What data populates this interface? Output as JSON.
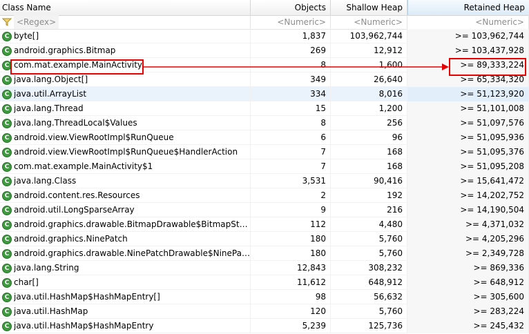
{
  "columns": {
    "class_name": "Class Name",
    "objects": "Objects",
    "shallow_heap": "Shallow Heap",
    "retained_heap": "Retained Heap"
  },
  "filters": {
    "class_name": "<Regex>",
    "objects": "<Numeric>",
    "shallow_heap": "<Numeric>",
    "retained_heap": "<Numeric>"
  },
  "rows": [
    {
      "name": "byte[]",
      "objects": "1,837",
      "shallow": "103,962,744",
      "retained": ">= 103,962,744"
    },
    {
      "name": "android.graphics.Bitmap",
      "objects": "269",
      "shallow": "12,912",
      "retained": ">= 103,437,928"
    },
    {
      "name": "com.mat.example.MainActivity",
      "objects": "8",
      "shallow": "1,600",
      "retained": ">= 89,333,224"
    },
    {
      "name": "java.lang.Object[]",
      "objects": "349",
      "shallow": "26,640",
      "retained": ">= 65,334,320"
    },
    {
      "name": "java.util.ArrayList",
      "objects": "334",
      "shallow": "8,016",
      "retained": ">= 51,123,920"
    },
    {
      "name": "java.lang.Thread",
      "objects": "15",
      "shallow": "1,200",
      "retained": ">= 51,101,008"
    },
    {
      "name": "java.lang.ThreadLocal$Values",
      "objects": "8",
      "shallow": "256",
      "retained": ">= 51,097,576"
    },
    {
      "name": "android.view.ViewRootImpl$RunQueue",
      "objects": "6",
      "shallow": "96",
      "retained": ">= 51,095,936"
    },
    {
      "name": "android.view.ViewRootImpl$RunQueue$HandlerAction",
      "objects": "7",
      "shallow": "168",
      "retained": ">= 51,095,376"
    },
    {
      "name": "com.mat.example.MainActivity$1",
      "objects": "7",
      "shallow": "168",
      "retained": ">= 51,095,208"
    },
    {
      "name": "java.lang.Class",
      "objects": "3,531",
      "shallow": "90,416",
      "retained": ">= 15,641,472"
    },
    {
      "name": "android.content.res.Resources",
      "objects": "2",
      "shallow": "192",
      "retained": ">= 14,202,752"
    },
    {
      "name": "android.util.LongSparseArray",
      "objects": "9",
      "shallow": "216",
      "retained": ">= 14,190,504"
    },
    {
      "name": "android.graphics.drawable.BitmapDrawable$BitmapState",
      "objects": "112",
      "shallow": "4,480",
      "retained": ">= 4,371,032"
    },
    {
      "name": "android.graphics.NinePatch",
      "objects": "180",
      "shallow": "5,760",
      "retained": ">= 4,205,296"
    },
    {
      "name": "android.graphics.drawable.NinePatchDrawable$NinePat...",
      "objects": "180",
      "shallow": "5,760",
      "retained": ">= 2,349,728"
    },
    {
      "name": "java.lang.String",
      "objects": "12,843",
      "shallow": "308,232",
      "retained": ">= 869,336"
    },
    {
      "name": "char[]",
      "objects": "11,612",
      "shallow": "648,912",
      "retained": ">= 648,912"
    },
    {
      "name": "java.util.HashMap$HashMapEntry[]",
      "objects": "98",
      "shallow": "56,632",
      "retained": ">= 305,600"
    },
    {
      "name": "java.util.HashMap",
      "objects": "120",
      "shallow": "5,760",
      "retained": ">= 283,224"
    },
    {
      "name": "java.util.HashMap$HashMapEntry",
      "objects": "5,239",
      "shallow": "125,736",
      "retained": ">= 245,432"
    }
  ],
  "selected_row": 4,
  "sorted_column": "retained_heap",
  "annotation_color": "#e60000",
  "class_icon_color": "#3e9a3e"
}
